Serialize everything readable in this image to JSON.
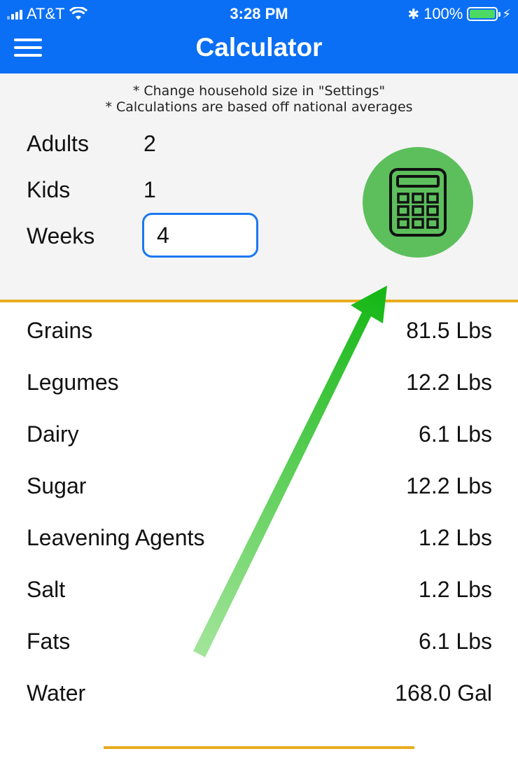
{
  "status_bar": {
    "carrier": "AT&T",
    "time": "3:28 PM",
    "battery": "100%"
  },
  "header": {
    "title": "Calculator",
    "color": "#0a6ff5"
  },
  "notes": {
    "line1": "* Change household size in \"Settings\"",
    "line2": "* Calculations are based off national averages"
  },
  "household": {
    "adults_label": "Adults",
    "adults_value": "2",
    "kids_label": "Kids",
    "kids_value": "1",
    "weeks_label": "Weeks",
    "weeks_value": "4"
  },
  "calculate_button": {
    "icon": "calculator-icon",
    "color": "#5cbf5c"
  },
  "results": [
    {
      "name": "Grains",
      "amount": "81.5 Lbs"
    },
    {
      "name": "Legumes",
      "amount": "12.2 Lbs"
    },
    {
      "name": "Dairy",
      "amount": "6.1 Lbs"
    },
    {
      "name": "Sugar",
      "amount": "12.2 Lbs"
    },
    {
      "name": "Leavening Agents",
      "amount": "1.2 Lbs"
    },
    {
      "name": "Salt",
      "amount": "1.2 Lbs"
    },
    {
      "name": "Fats",
      "amount": "6.1 Lbs"
    },
    {
      "name": "Water",
      "amount": "168.0 Gal"
    }
  ],
  "accent_color": "#e8ad1f",
  "annotation": {
    "type": "arrow",
    "color": "#22bb22"
  }
}
